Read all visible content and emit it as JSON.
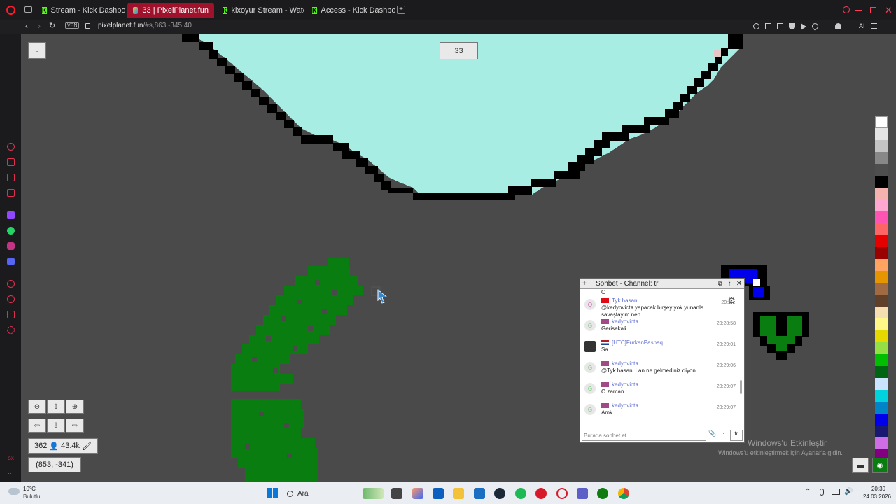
{
  "browser": {
    "tabs": [
      {
        "label": "Stream - Kick Dashboard",
        "active": false
      },
      {
        "label": "33 | PixelPlanet.fun",
        "active": true
      },
      {
        "label": "kixoyur Stream - Watch Li",
        "active": false
      },
      {
        "label": "Access - Kick Dashboard",
        "active": false
      }
    ],
    "vpn_label": "VPN",
    "url_host": "pixelplanet.fun",
    "url_hash": "/#s,863,-345,40",
    "ai_label": "AI"
  },
  "canvas": {
    "canvas_badge": "33",
    "stats": {
      "online": "362",
      "pixels": "43.4k"
    },
    "coordinates": "(853, -341)"
  },
  "chat": {
    "title": "Sohbet - Channel: tr",
    "messages": [
      {
        "avatar": "",
        "name": "",
        "time": "",
        "text": "O",
        "flag": ""
      },
      {
        "avatar": "Q",
        "name": "Tyk hasani",
        "time": "20:2…",
        "text": "@kedyovictя yapacak birşey yok yunanla savaştayım nen",
        "flag": "tr"
      },
      {
        "avatar": "G",
        "name": "kedyovictя",
        "time": "20:28:58",
        "text": "Gerisekali",
        "flag": "uk"
      },
      {
        "avatar": "",
        "name": "[HTC]FurkanPashaq",
        "time": "20:29:01",
        "text": "Sa",
        "flag": "nl"
      },
      {
        "avatar": "G",
        "name": "kedyovictя",
        "time": "20:29:06",
        "text": "@Tyk hasani Lan ne gelmediniz diyon",
        "flag": "uk"
      },
      {
        "avatar": "G",
        "name": "kedyovictя",
        "time": "20:29:07",
        "text": "O zaman",
        "flag": "uk"
      },
      {
        "avatar": "G",
        "name": "kedyovictя",
        "time": "20:29:07",
        "text": "Amk",
        "flag": "uk"
      }
    ],
    "input_placeholder": "Burada sohbet et",
    "channel_button": "tr"
  },
  "windows_watermark": {
    "title": "Windows'u Etkinleştir",
    "subtitle": "Windows'u etkinleştirmek için Ayarlar'a gidin."
  },
  "taskbar": {
    "weather_temp": "10°C",
    "weather_desc": "Bulutlu",
    "search_label": "Ara",
    "time": "20:30",
    "date": "24.03.2026"
  },
  "palette": [
    "#ffffff",
    "#e4e4e4",
    "#c4c4c4",
    "#888888",
    "#4e4e4e",
    "#000000",
    "#f4b3ae",
    "#ffa7d1",
    "#ff54b2",
    "#ff6565",
    "#e50000",
    "#9a0000",
    "#fea460",
    "#e59500",
    "#a06a42",
    "#604028",
    "#f5dfb0",
    "#fff889",
    "#e5d900",
    "#94e044",
    "#02be01",
    "#006513",
    "#cae3ff",
    "#00d3dd",
    "#0083c7",
    "#0000ea",
    "#191973",
    "#cf6ee4",
    "#820080"
  ],
  "colors": {
    "accent": "#a0122c",
    "sky": "#a8ede4",
    "canvas_bg": "#4a4a4a",
    "pixel_green": "#0a7d10"
  }
}
